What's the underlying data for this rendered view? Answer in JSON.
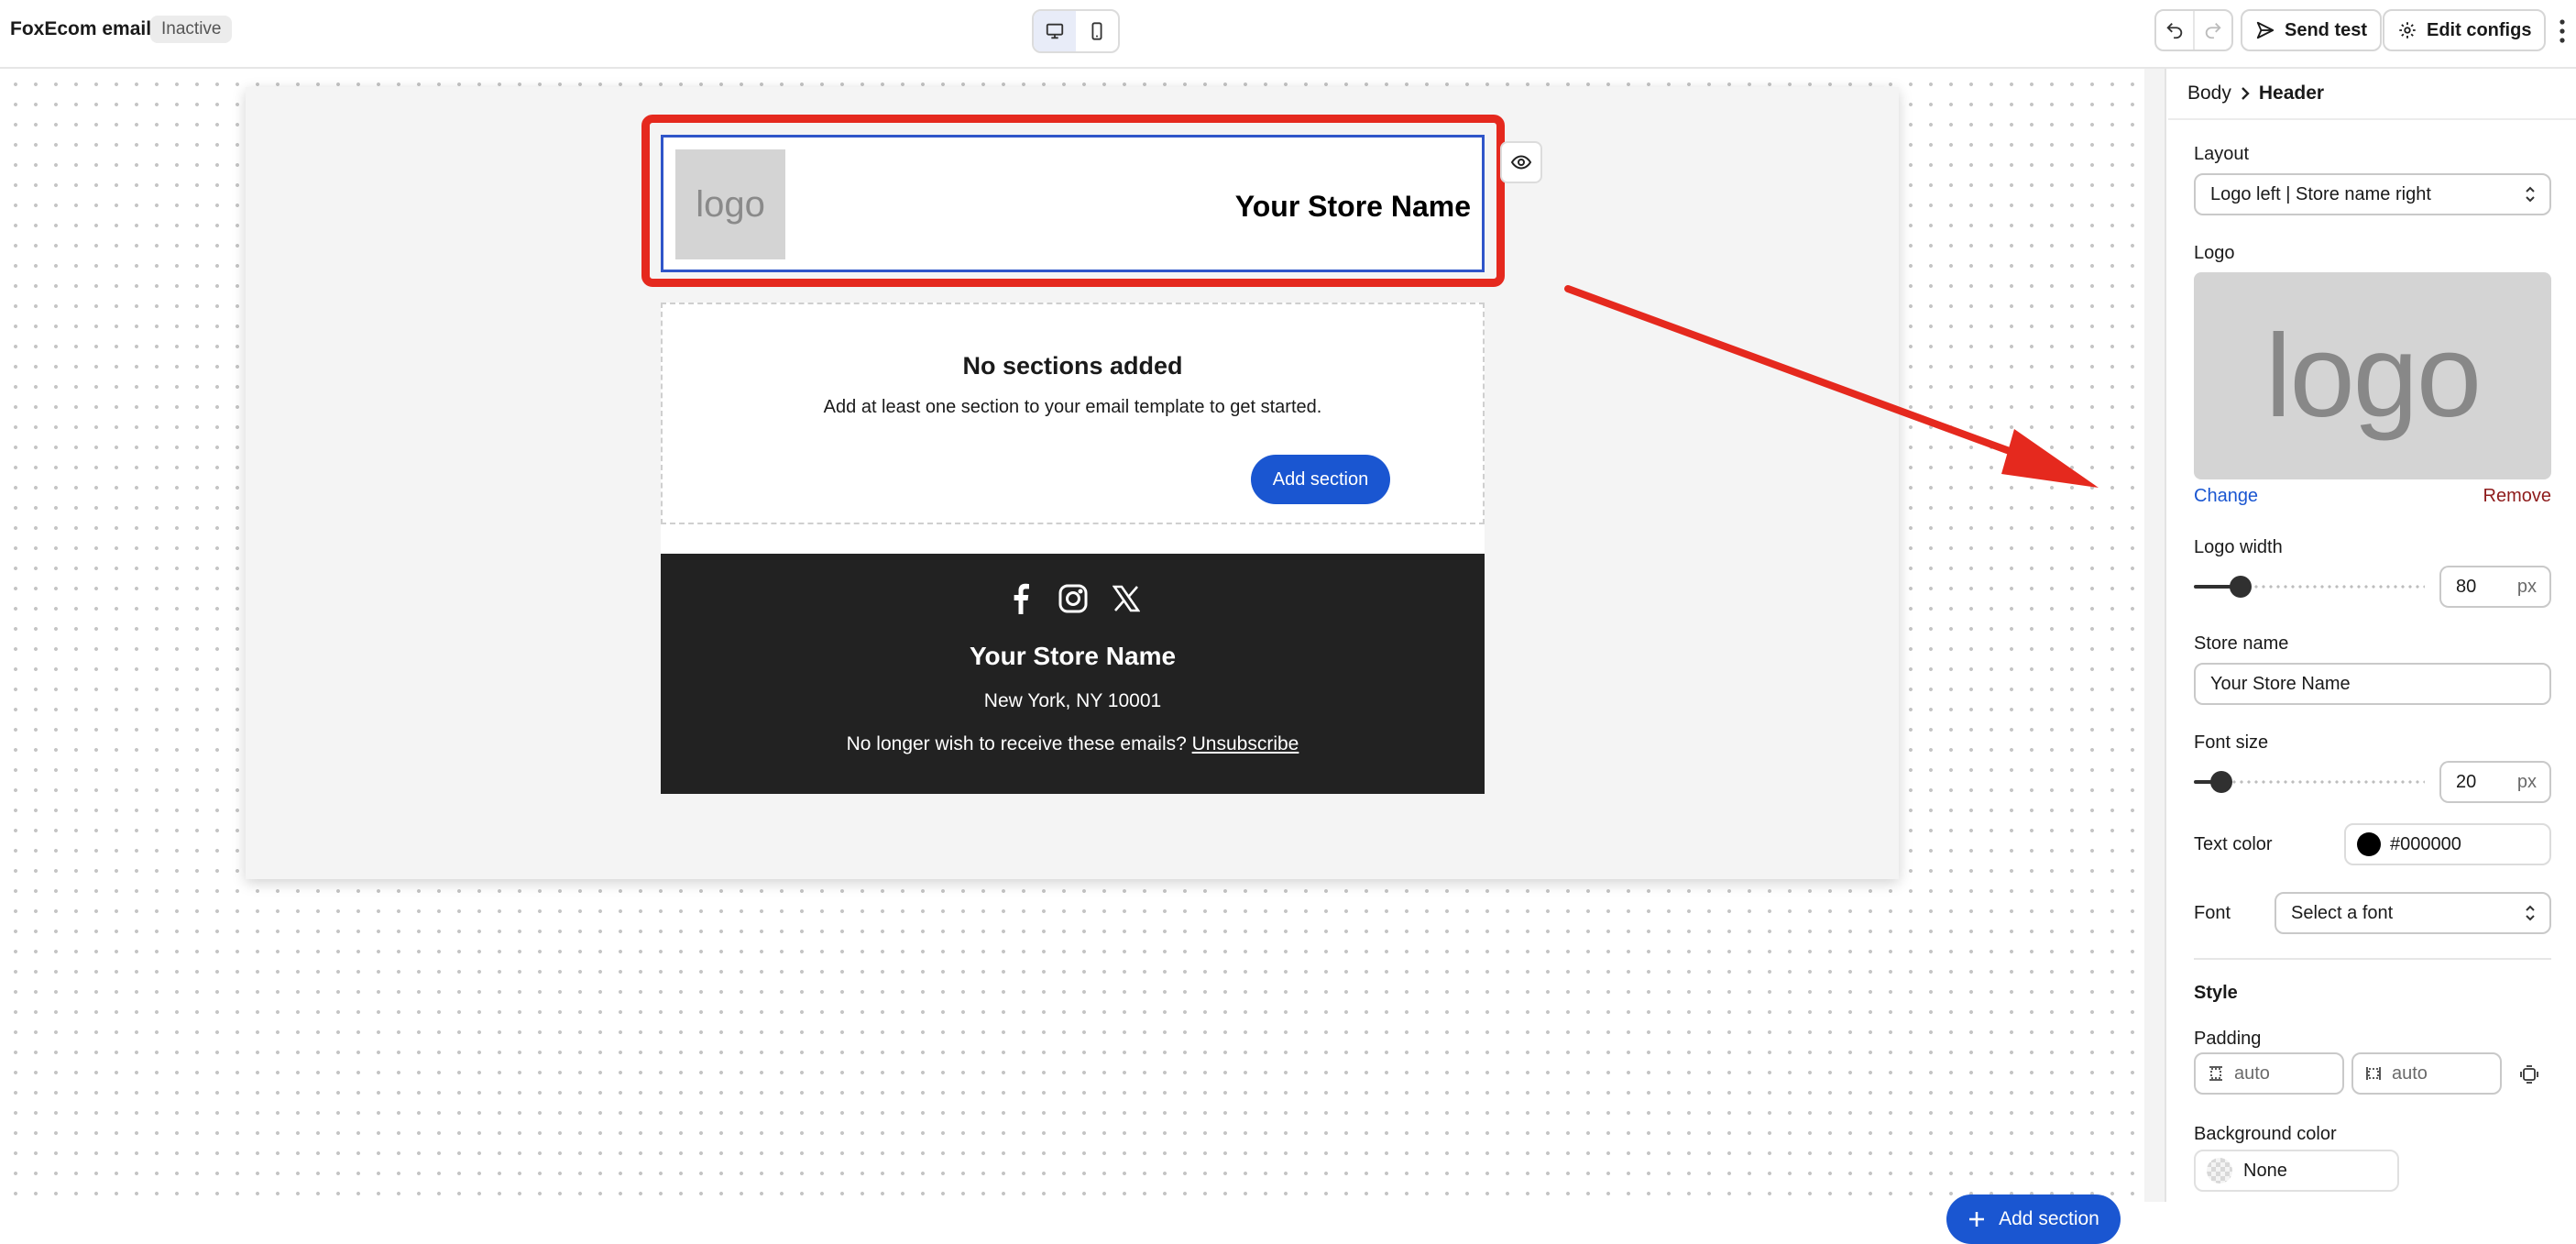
{
  "app": {
    "title": "FoxEcom email",
    "status": "Inactive"
  },
  "toolbar": {
    "send_test_label": "Send test",
    "edit_configs_label": "Edit configs"
  },
  "email": {
    "header": {
      "logo_text": "logo",
      "store_name": "Your Store Name"
    },
    "empty_section": {
      "title": "No sections added",
      "description": "Add at least one section to your email template to get started.",
      "button_label": "Add section"
    },
    "footer": {
      "social": [
        "facebook-icon",
        "instagram-icon",
        "x-icon"
      ],
      "store_name": "Your Store Name",
      "address": "New York, NY 10001",
      "unsubscribe_prefix": "No longer wish to receive these emails?",
      "unsubscribe_link": "Unsubscribe"
    }
  },
  "canvas": {
    "add_section_label": "Add section"
  },
  "annotation": {
    "highlight_color": "#e5291e"
  },
  "panel": {
    "breadcrumb": {
      "parent": "Body",
      "current": "Header"
    },
    "layout": {
      "label": "Layout",
      "value": "Logo left | Store name right"
    },
    "logo": {
      "label": "Logo",
      "preview_text": "logo",
      "change_label": "Change",
      "remove_label": "Remove"
    },
    "logo_width": {
      "label": "Logo width",
      "value": "80",
      "unit": "px",
      "slider_fraction": 0.17
    },
    "store_name": {
      "label": "Store name",
      "value": "Your Store Name"
    },
    "font_size": {
      "label": "Font size",
      "value": "20",
      "unit": "px",
      "slider_fraction": 0.08
    },
    "text_color": {
      "label": "Text color",
      "value": "#000000"
    },
    "font": {
      "label": "Font",
      "placeholder": "Select a font"
    },
    "style": {
      "title": "Style",
      "padding": {
        "label": "Padding",
        "vertical": "auto",
        "horizontal": "auto"
      },
      "background_color": {
        "label": "Background color",
        "value": "None"
      }
    }
  },
  "colors": {
    "primary": "#1a56d1",
    "selection": "#2f55c9",
    "footer_bg": "#222222",
    "remove": "#8e1b1b"
  }
}
